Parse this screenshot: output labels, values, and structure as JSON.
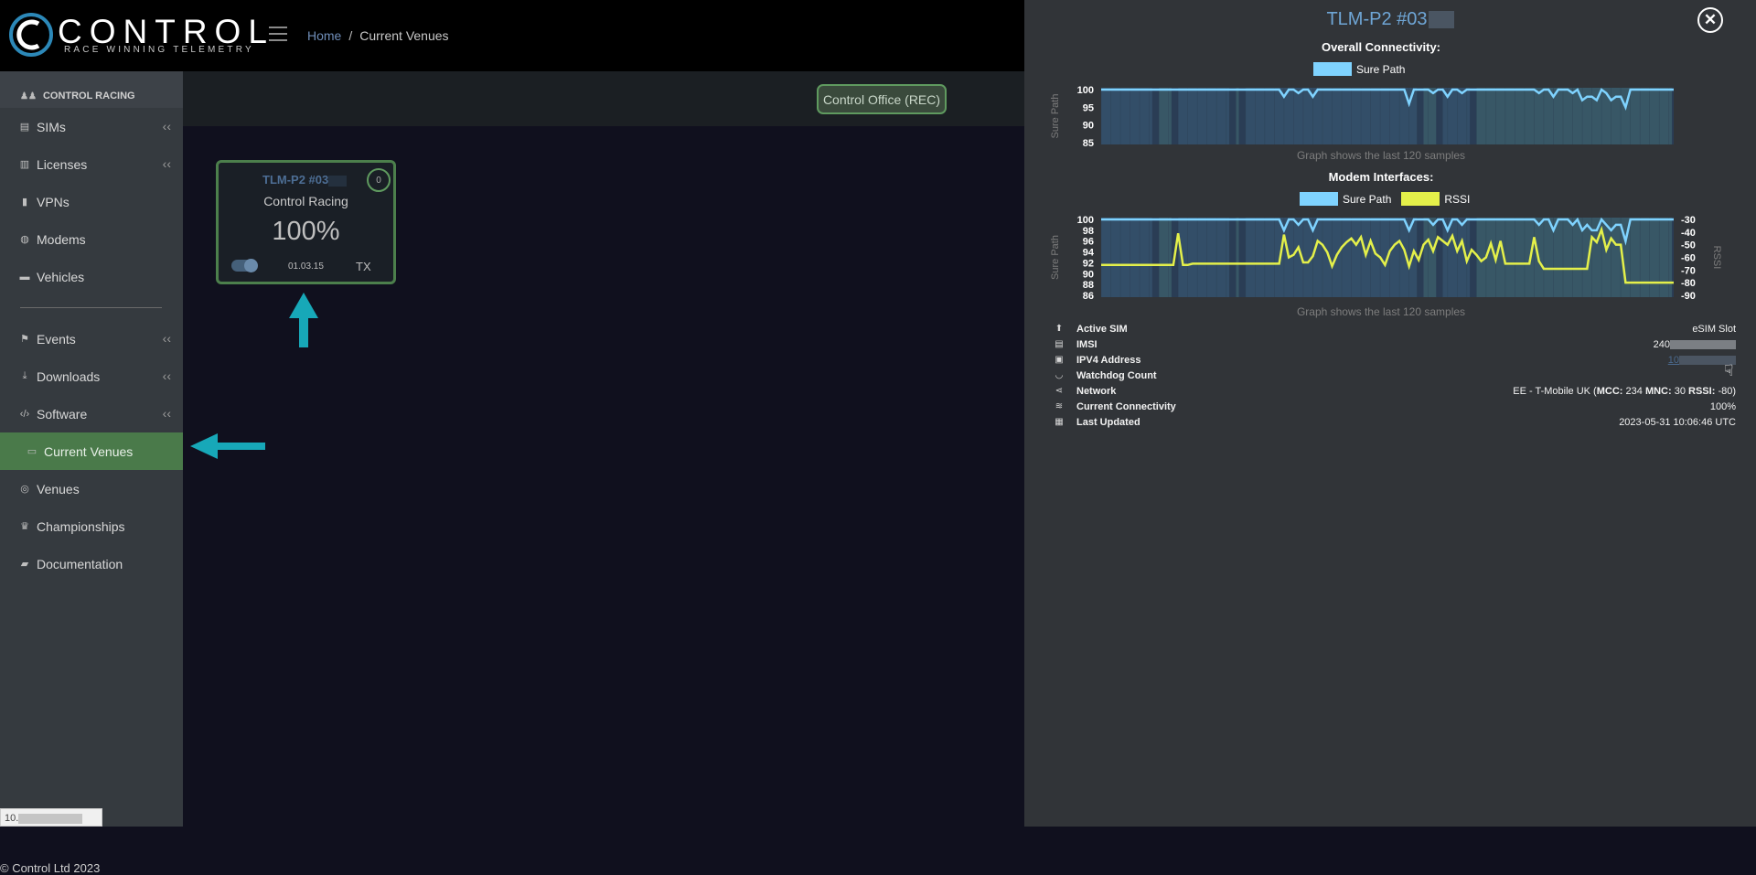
{
  "header": {
    "brand": "CONTROL",
    "tagline": "RACE WINNING TELEMETRY",
    "breadcrumb": {
      "home": "Home",
      "separator": "/",
      "current": "Current Venues"
    }
  },
  "sidebar": {
    "org": "CONTROL RACING",
    "items": [
      {
        "label": "SIMs",
        "icon": "file-icon",
        "chevron": "‹‹"
      },
      {
        "label": "Licenses",
        "icon": "id-card-icon",
        "chevron": "‹‹"
      },
      {
        "label": "VPNs",
        "icon": "lock-icon"
      },
      {
        "label": "Modems",
        "icon": "database-icon"
      },
      {
        "label": "Vehicles",
        "icon": "car-icon"
      },
      {
        "label": "Events",
        "icon": "flag-icon",
        "chevron": "‹‹"
      },
      {
        "label": "Downloads",
        "icon": "download-icon",
        "chevron": "‹‹"
      },
      {
        "label": "Software",
        "icon": "code-icon",
        "chevron": "‹‹"
      },
      {
        "label": "Current Venues",
        "icon": "inbox-icon",
        "active": true
      },
      {
        "label": "Venues",
        "icon": "globe-icon"
      },
      {
        "label": "Championships",
        "icon": "trophy-icon"
      },
      {
        "label": "Documentation",
        "icon": "book-icon"
      }
    ],
    "copyright": "© Control Ltd 2023",
    "ip_prefix": "10."
  },
  "toolbar": {
    "office_button": "Control Office (REC)"
  },
  "card": {
    "title": "TLM-P2 #03",
    "badge": "0",
    "org": "Control Racing",
    "connectivity": "100%",
    "date": "01.03.15",
    "mode": "TX"
  },
  "panel": {
    "title": "TLM-P2 #03",
    "close_icon": "close-icon",
    "overall_title": "Overall Connectivity:",
    "modem_title": "Modem Interfaces:",
    "caption": "Graph shows the last 120 samples",
    "legend": {
      "sure_path": "Sure Path",
      "rssi": "RSSI"
    },
    "details": [
      {
        "icon": "upload-icon",
        "glyph": "⬆",
        "label": "Active SIM",
        "value": "eSIM Slot"
      },
      {
        "icon": "sim-icon",
        "glyph": "▤",
        "label": "IMSI",
        "value": "240"
      },
      {
        "icon": "address-icon",
        "glyph": "▣",
        "label": "IPV4 Address",
        "value": "10"
      },
      {
        "icon": "rss-icon",
        "glyph": "◡",
        "label": "Watchdog Count",
        "value": ""
      },
      {
        "icon": "share-icon",
        "glyph": "⋖",
        "label": "Network",
        "value_prefix": "EE - T-Mobile UK  (",
        "mcc_label": "MCC:",
        "mcc": "234",
        "mnc_label": "MNC:",
        "mnc": "30",
        "rssi_label": "RSSI:",
        "rssi": "-80)"
      },
      {
        "icon": "wifi-icon",
        "glyph": "≋",
        "label": "Current Connectivity",
        "value": "100%"
      },
      {
        "icon": "calendar-icon",
        "glyph": "▦",
        "label": "Last Updated",
        "value": "2023-05-31 10:06:46 UTC"
      }
    ]
  },
  "colors": {
    "sure_path": "#7fd3ff",
    "rssi": "#e4f04a",
    "accent_green": "#4a7a4a",
    "link_blue": "#6fa6d6",
    "arrow_teal": "#17a8b8"
  },
  "chart_data": [
    {
      "type": "line",
      "title": "Overall Connectivity:",
      "ylabel": "Sure Path",
      "ylim": [
        85,
        100
      ],
      "yticks": [
        100,
        95,
        90,
        85
      ],
      "caption": "Graph shows the last 120 samples",
      "series": [
        {
          "name": "Sure Path",
          "values": [
            100,
            100,
            100,
            100,
            100,
            100,
            100,
            100,
            100,
            100,
            100,
            100,
            100,
            100,
            100,
            100,
            100,
            100,
            100,
            100,
            100,
            100,
            100,
            100,
            100,
            100,
            100,
            100,
            100,
            100,
            100,
            100,
            100,
            100,
            100,
            100,
            100,
            100,
            98,
            100,
            100,
            99,
            100,
            100,
            98,
            100,
            100,
            100,
            100,
            100,
            100,
            100,
            100,
            100,
            100,
            100,
            100,
            100,
            100,
            100,
            100,
            100,
            100,
            100,
            96,
            100,
            100,
            100,
            100,
            99,
            100,
            100,
            98,
            100,
            100,
            99,
            100,
            100,
            100,
            100,
            100,
            100,
            100,
            100,
            100,
            100,
            100,
            100,
            100,
            100,
            100,
            99,
            100,
            100,
            98,
            100,
            100,
            100,
            99,
            100,
            97,
            98,
            98,
            97,
            100,
            99,
            97,
            98,
            98,
            95,
            100,
            100,
            100,
            100,
            100,
            100,
            100,
            100,
            100,
            100
          ]
        }
      ]
    },
    {
      "type": "line",
      "title": "Modem Interfaces:",
      "ylabel": "Sure Path",
      "y2label": "RSSI",
      "ylim": [
        86,
        100
      ],
      "yticks": [
        100,
        98,
        96,
        94,
        92,
        90,
        88,
        86
      ],
      "y2lim": [
        -90,
        -30
      ],
      "y2ticks": [
        -30,
        -40,
        -50,
        -60,
        -70,
        -80,
        -90
      ],
      "caption": "Graph shows the last 120 samples",
      "series": [
        {
          "name": "Sure Path",
          "axis": "left",
          "values": [
            100,
            100,
            100,
            100,
            100,
            100,
            100,
            100,
            100,
            100,
            100,
            100,
            100,
            100,
            100,
            100,
            100,
            100,
            100,
            100,
            100,
            100,
            100,
            100,
            100,
            100,
            100,
            100,
            100,
            100,
            100,
            100,
            100,
            100,
            100,
            100,
            100,
            100,
            98,
            100,
            100,
            99,
            100,
            100,
            98,
            100,
            100,
            100,
            100,
            100,
            100,
            100,
            100,
            100,
            100,
            100,
            100,
            100,
            100,
            100,
            100,
            100,
            100,
            100,
            98,
            100,
            100,
            100,
            100,
            99,
            100,
            100,
            98,
            100,
            100,
            99,
            100,
            100,
            100,
            100,
            100,
            100,
            100,
            100,
            100,
            100,
            100,
            100,
            100,
            100,
            100,
            99,
            100,
            100,
            98,
            100,
            100,
            100,
            99,
            100,
            98,
            99,
            98,
            98,
            100,
            99,
            98,
            99,
            99,
            96,
            100,
            100,
            100,
            100,
            100,
            100,
            100,
            100,
            100,
            100
          ]
        },
        {
          "name": "RSSI",
          "axis": "right",
          "values": [
            -66,
            -66,
            -66,
            -66,
            -66,
            -66,
            -66,
            -66,
            -66,
            -66,
            -66,
            -66,
            -66,
            -66,
            -66,
            -66,
            -41,
            -66,
            -66,
            -65,
            -65,
            -65,
            -65,
            -65,
            -65,
            -65,
            -65,
            -65,
            -65,
            -65,
            -65,
            -65,
            -65,
            -65,
            -65,
            -65,
            -65,
            -65,
            -42,
            -60,
            -58,
            -52,
            -64,
            -64,
            -59,
            -47,
            -50,
            -56,
            -67,
            -58,
            -52,
            -48,
            -45,
            -50,
            -44,
            -58,
            -47,
            -57,
            -60,
            -66,
            -55,
            -50,
            -47,
            -54,
            -67,
            -55,
            -62,
            -50,
            -46,
            -55,
            -44,
            -47,
            -50,
            -43,
            -55,
            -47,
            -63,
            -54,
            -58,
            -63,
            -60,
            -49,
            -62,
            -47,
            -65,
            -65,
            -65,
            -65,
            -65,
            -65,
            -44,
            -63,
            -69,
            -69,
            -69,
            -69,
            -69,
            -69,
            -69,
            -69,
            -69,
            -69,
            -44,
            -48,
            -38,
            -54,
            -45,
            -50,
            -50,
            -80,
            -80,
            -80,
            -80,
            -80,
            -80,
            -80,
            -80,
            -80,
            -80,
            -80
          ]
        }
      ]
    }
  ]
}
